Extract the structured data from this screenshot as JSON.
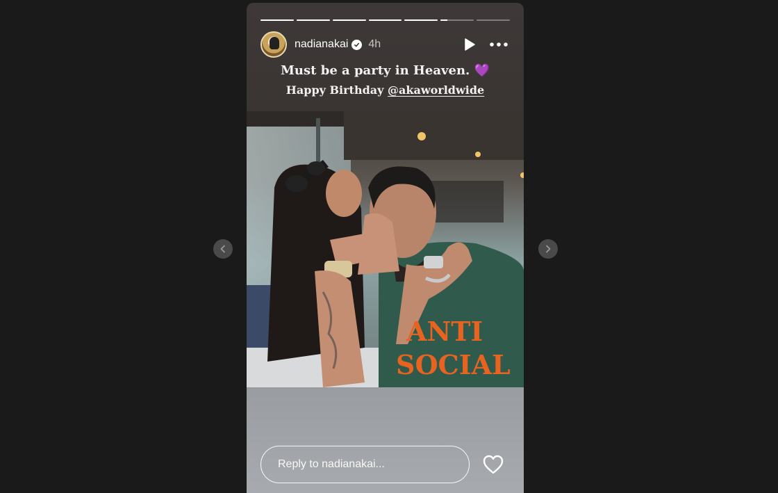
{
  "story": {
    "username": "nadianakai",
    "time_ago": "4h",
    "progress_segments": [
      1,
      1,
      1,
      1,
      1,
      0.2,
      0
    ],
    "caption_line1": "Must be a party in Heaven. 💜",
    "caption_line2_prefix": "Happy Birthday ",
    "caption_mention": "@akaworldwide",
    "photo_shirt_text_1": "ANTI",
    "photo_shirt_text_2": "SOCIAL",
    "reply_placeholder": "Reply to nadianakai..."
  },
  "icons": {
    "verified": "verified-badge-icon",
    "play": "play-icon",
    "more": "more-options-icon",
    "like": "heart-icon",
    "prev": "chevron-left-icon",
    "next": "chevron-right-icon"
  },
  "colors": {
    "page_background": "#1a1a1a",
    "shirt": "#2f5a4c",
    "shirt_print": "#e6641f"
  }
}
